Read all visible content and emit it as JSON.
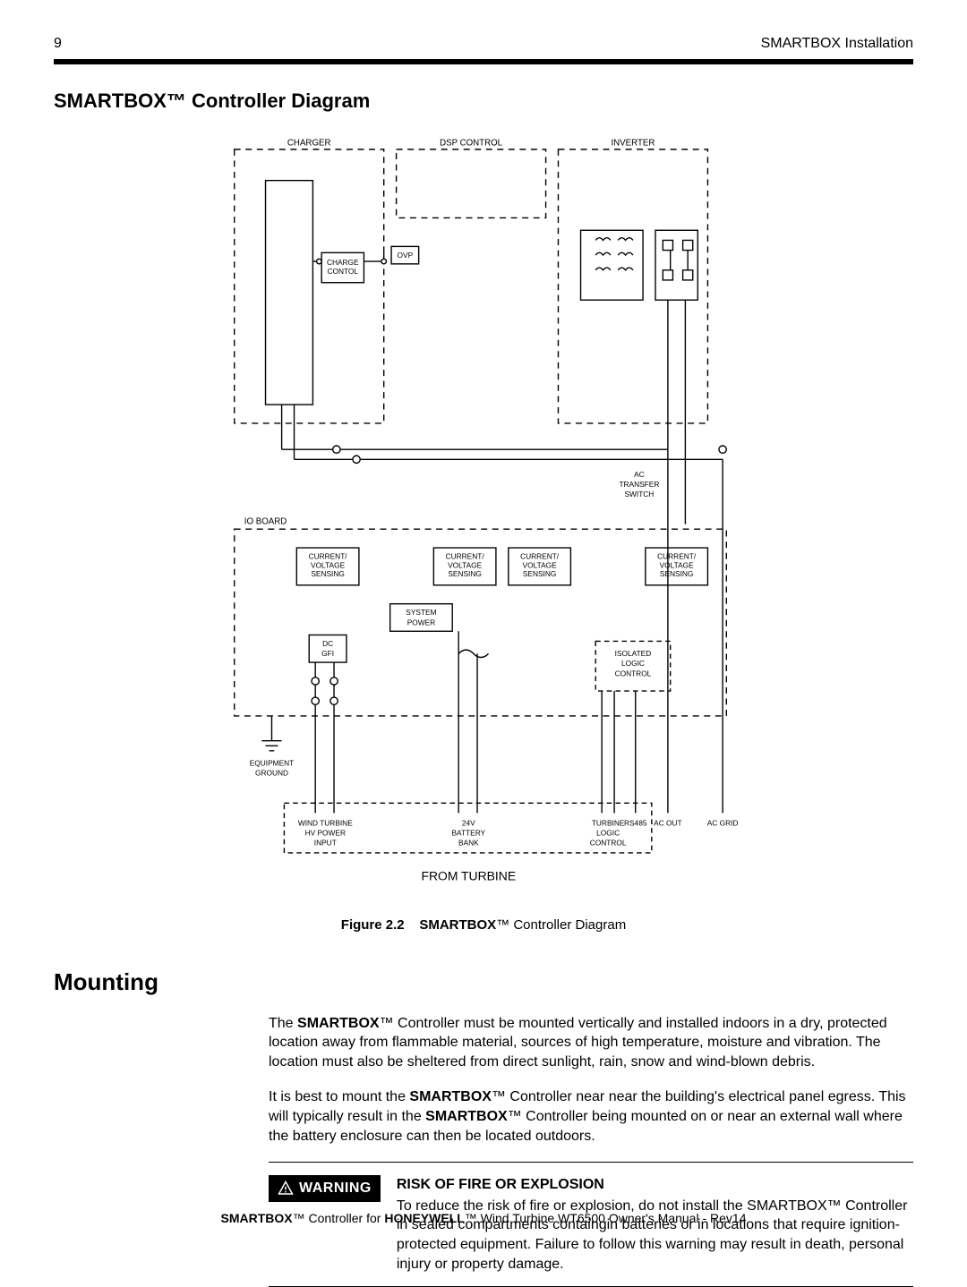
{
  "header": {
    "page_number": "9",
    "running_head": "SMARTBOX Installation"
  },
  "section": {
    "title": "SMARTBOX™ Controller Diagram",
    "caption_prefix": "Figure 2.2",
    "caption_text": "SMARTBOX™ Controller Diagram"
  },
  "diagram": {
    "blocks": {
      "charger": "CHARGER",
      "dsp_control": "DSP CONTROL",
      "inverter": "INVERTER",
      "charge_control_l1": "CHARGE",
      "charge_control_l2": "CONTOL",
      "ovp": "OVP",
      "ac_transfer_l1": "AC",
      "ac_transfer_l2": "TRANSFER",
      "ac_transfer_l3": "SWITCH",
      "io_board": "IO BOARD",
      "cv_sensing_l1": "CURRENT/",
      "cv_sensing_l2": "VOLTAGE",
      "cv_sensing_l3": "SENSING",
      "system_power_l1": "SYSTEM",
      "system_power_l2": "POWER",
      "dc_gfi_l1": "DC",
      "dc_gfi_l2": "GFI",
      "isolated_logic_l1": "ISOLATED",
      "isolated_logic_l2": "LOGIC",
      "isolated_logic_l3": "CONTROL",
      "equip_ground_l1": "EQUIPMENT",
      "equip_ground_l2": "GROUND"
    },
    "bottom_labels": {
      "wind_turbine_l1": "WIND TURBINE",
      "wind_turbine_l2": "HV POWER",
      "wind_turbine_l3": "INPUT",
      "battery_l1": "24V",
      "battery_l2": "BATTERY",
      "battery_l3": "BANK",
      "turbine_logic_l1": "TURBINE",
      "turbine_logic_l2": "LOGIC",
      "turbine_logic_l3": "CONTROL",
      "rs485": "RS485",
      "ac_out": "AC OUT",
      "ac_grid": "AC GRID"
    },
    "from_turbine": "FROM TURBINE"
  },
  "mounting": {
    "heading": "Mounting",
    "p1_a": "The ",
    "p1_b": "SMARTBOX",
    "p1_c": "™ Controller must be mounted vertically and installed indoors in a dry, protected location away from flammable material, sources of high temperature, moisture and vibration. The location must also be sheltered from direct sunlight, rain, snow and wind-blown debris.",
    "p2_a": "It is best to mount the ",
    "p2_b": "SMARTBOX",
    "p2_c": "™ Controller near near the building's electrical panel egress.  This will typically result in the ",
    "p2_d": "SMARTBOX",
    "p2_e": "™ Controller being mounted on or near an external wall where the battery enclosure can then be located outdoors."
  },
  "warning": {
    "badge": "WARNING",
    "title": "RISK OF FIRE OR EXPLOSION",
    "body_a": "To reduce the risk of fire or explosion, do not install the ",
    "body_b": "SMARTBOX",
    "body_c": "™ Controller in sealed compartments containgin batteries or in locations that require ignition-protected equipment. Failure to follow this warning may result in death, personal injury or property damage."
  },
  "footer": {
    "a": "SMARTBOX",
    "b": "™ Controller for ",
    "c": "HONEYWELL",
    "d": "™ Wind Turbine WT6500 Owner's Manual - Rev14"
  }
}
